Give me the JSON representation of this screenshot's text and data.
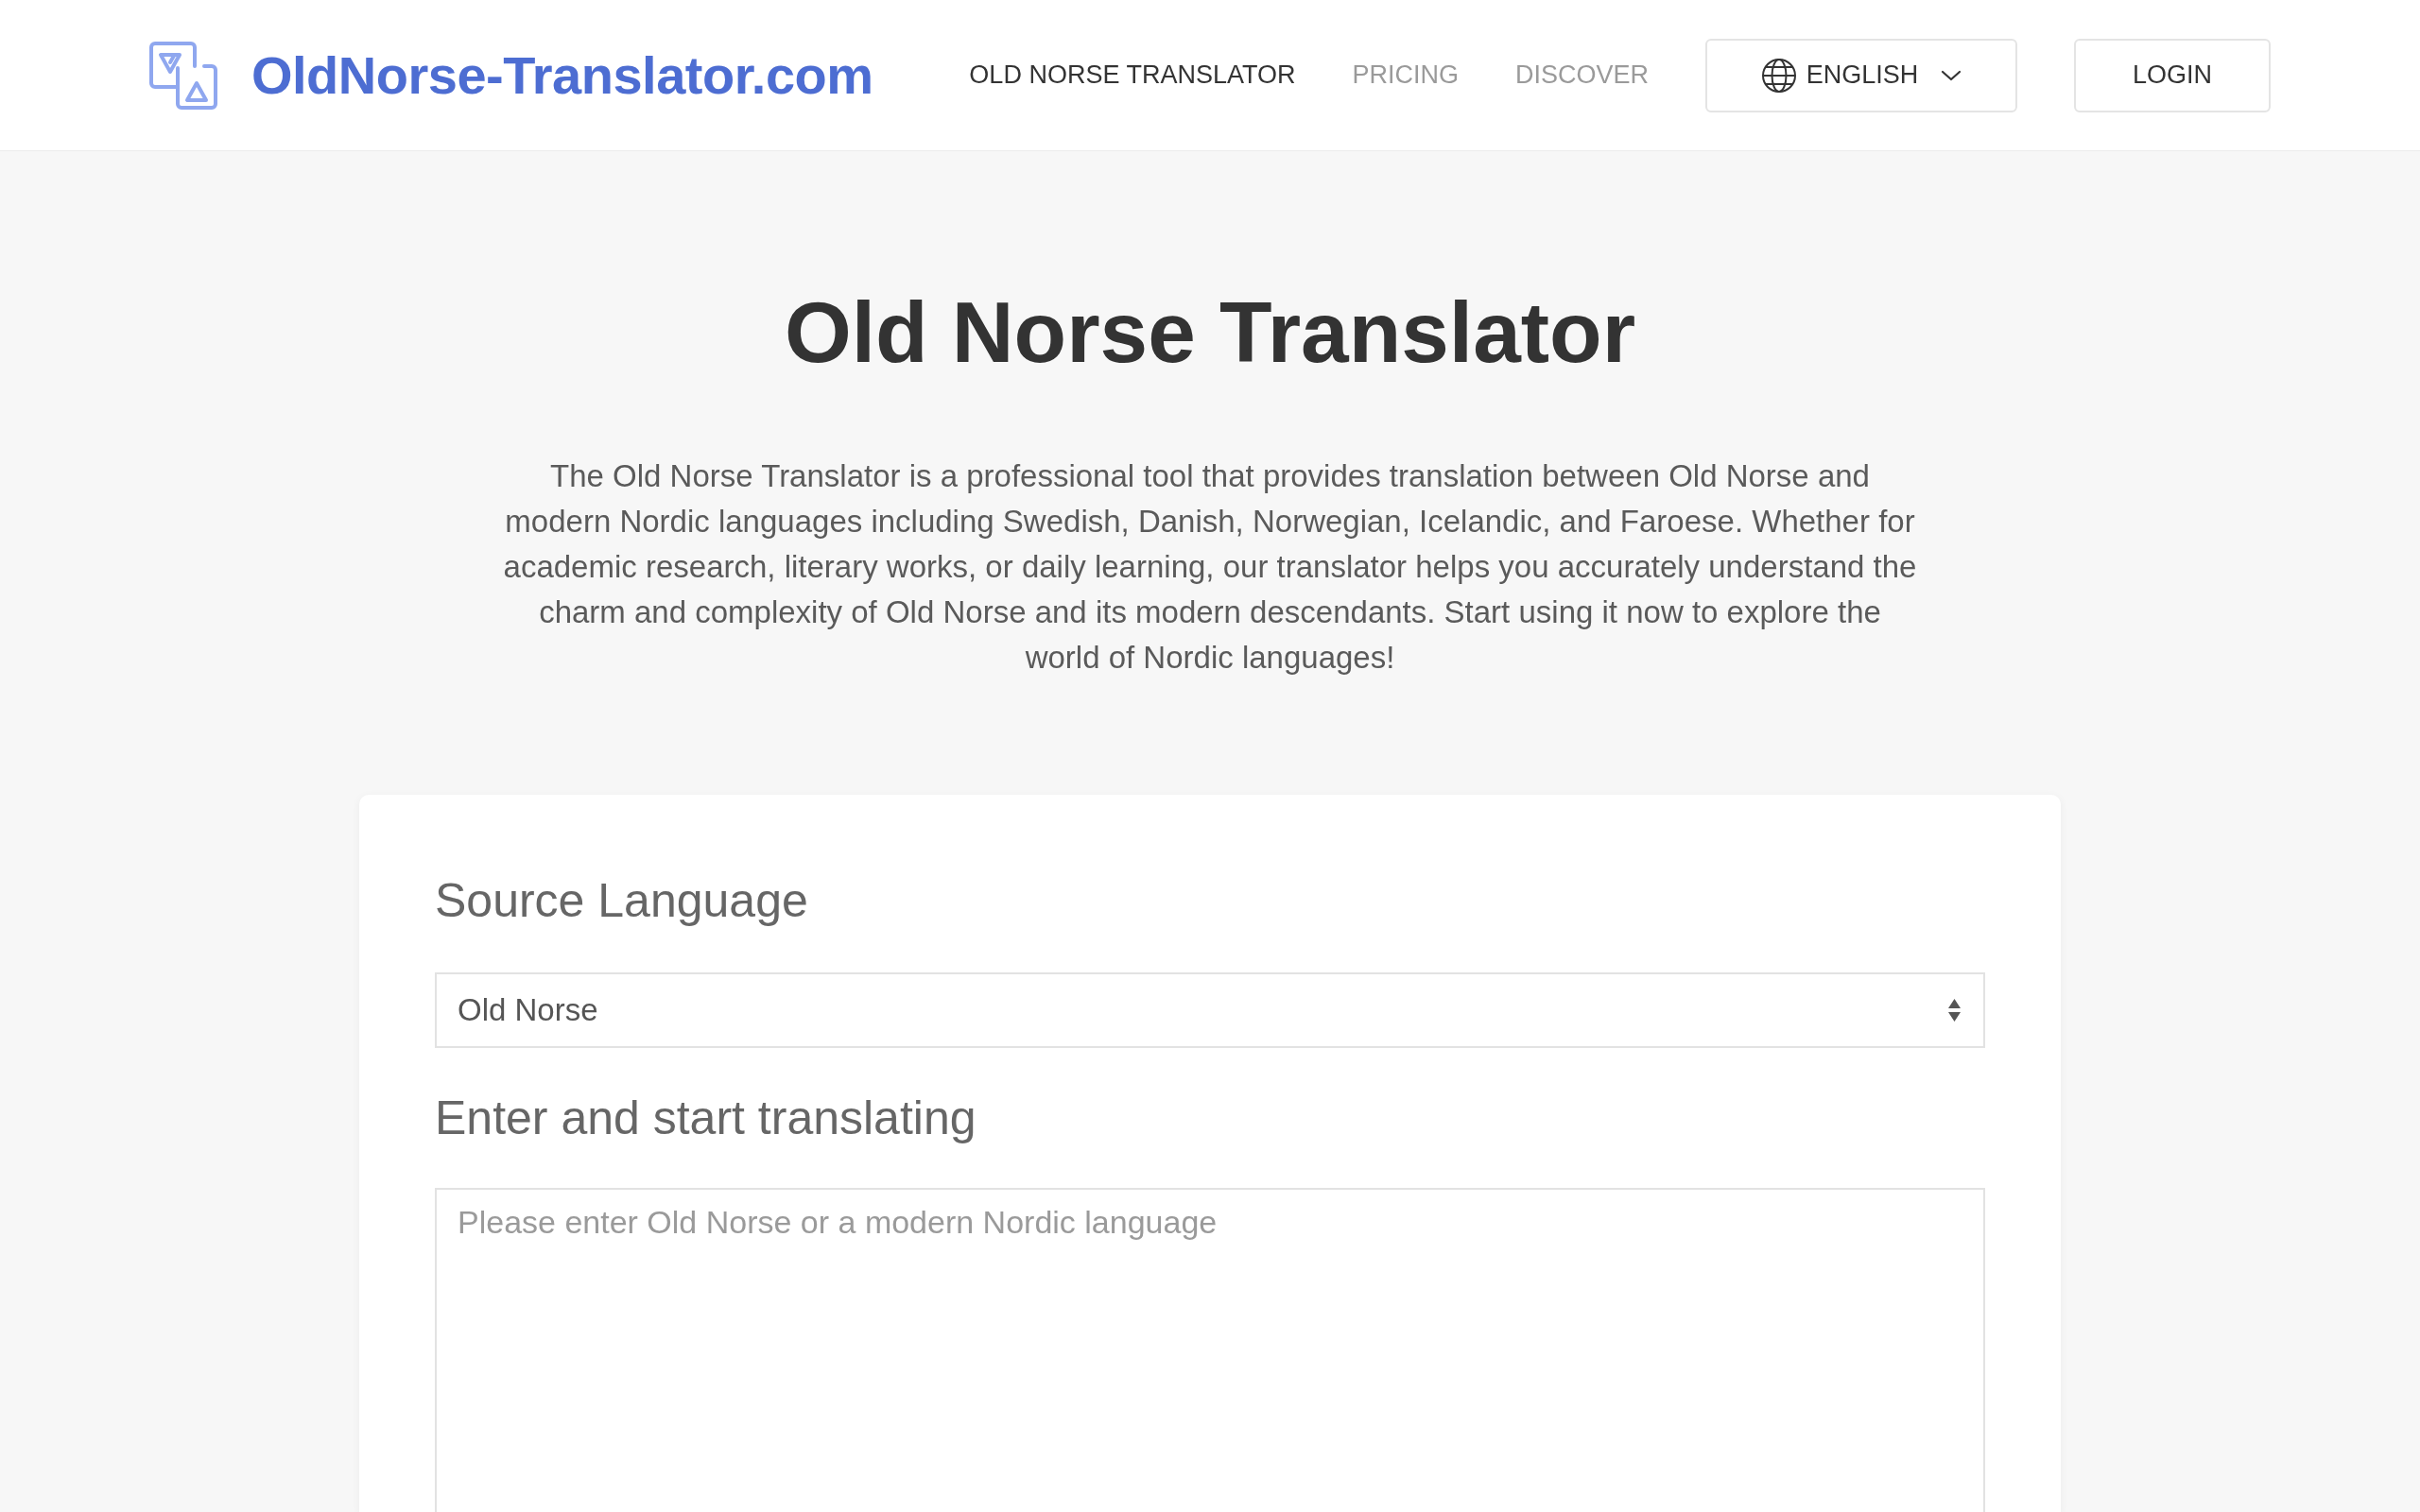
{
  "header": {
    "logo_text": "OldNorse-Translator.com",
    "nav": [
      {
        "label": "OLD NORSE TRANSLATOR",
        "selected": true
      },
      {
        "label": "PRICING",
        "selected": false
      },
      {
        "label": "DISCOVER",
        "selected": false
      }
    ],
    "language_button": "ENGLISH",
    "login_button": "LOGIN"
  },
  "hero": {
    "title": "Old Norse Translator",
    "description": "The Old Norse Translator is a professional tool that provides translation between Old Norse and modern Nordic languages including Swedish, Danish, Norwegian, Icelandic, and Faroese. Whether for academic research, literary works, or daily learning, our translator helps you accurately understand the charm and complexity of Old Norse and its modern descendants. Start using it now to explore the world of Nordic languages!"
  },
  "form": {
    "source_label": "Source Language",
    "source_select": {
      "value": "Old Norse"
    },
    "input_label": "Enter and start translating",
    "input_box": {
      "placeholder": "Please enter Old Norse or a modern Nordic language"
    }
  }
}
